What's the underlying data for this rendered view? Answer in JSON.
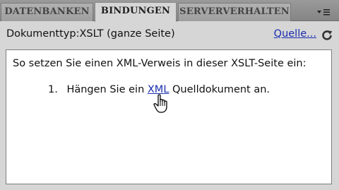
{
  "tabs": [
    {
      "label": "DATENBANKEN",
      "active": false
    },
    {
      "label": "BINDUNGEN",
      "active": true
    },
    {
      "label": "SERVERVERHALTEN",
      "active": false
    }
  ],
  "panel_menu_icon": "panel-menu-icon",
  "doctype": {
    "label": "Dokumenttyp:XSLT (ganze Seite)",
    "source_link": "Quelle...",
    "refresh_icon": "refresh-icon"
  },
  "content": {
    "instructions": "So setzen Sie einen XML-Verweis in dieser XSLT-Seite ein:",
    "step_number": "1.",
    "step_before": "Hängen Sie ein ",
    "step_link": "XML",
    "step_after": " Quelldokument an."
  },
  "colors": {
    "link": "#1a2fb0",
    "panel_bg": "#d6d6d6",
    "tabbar_bg": "#8e8e8e"
  }
}
